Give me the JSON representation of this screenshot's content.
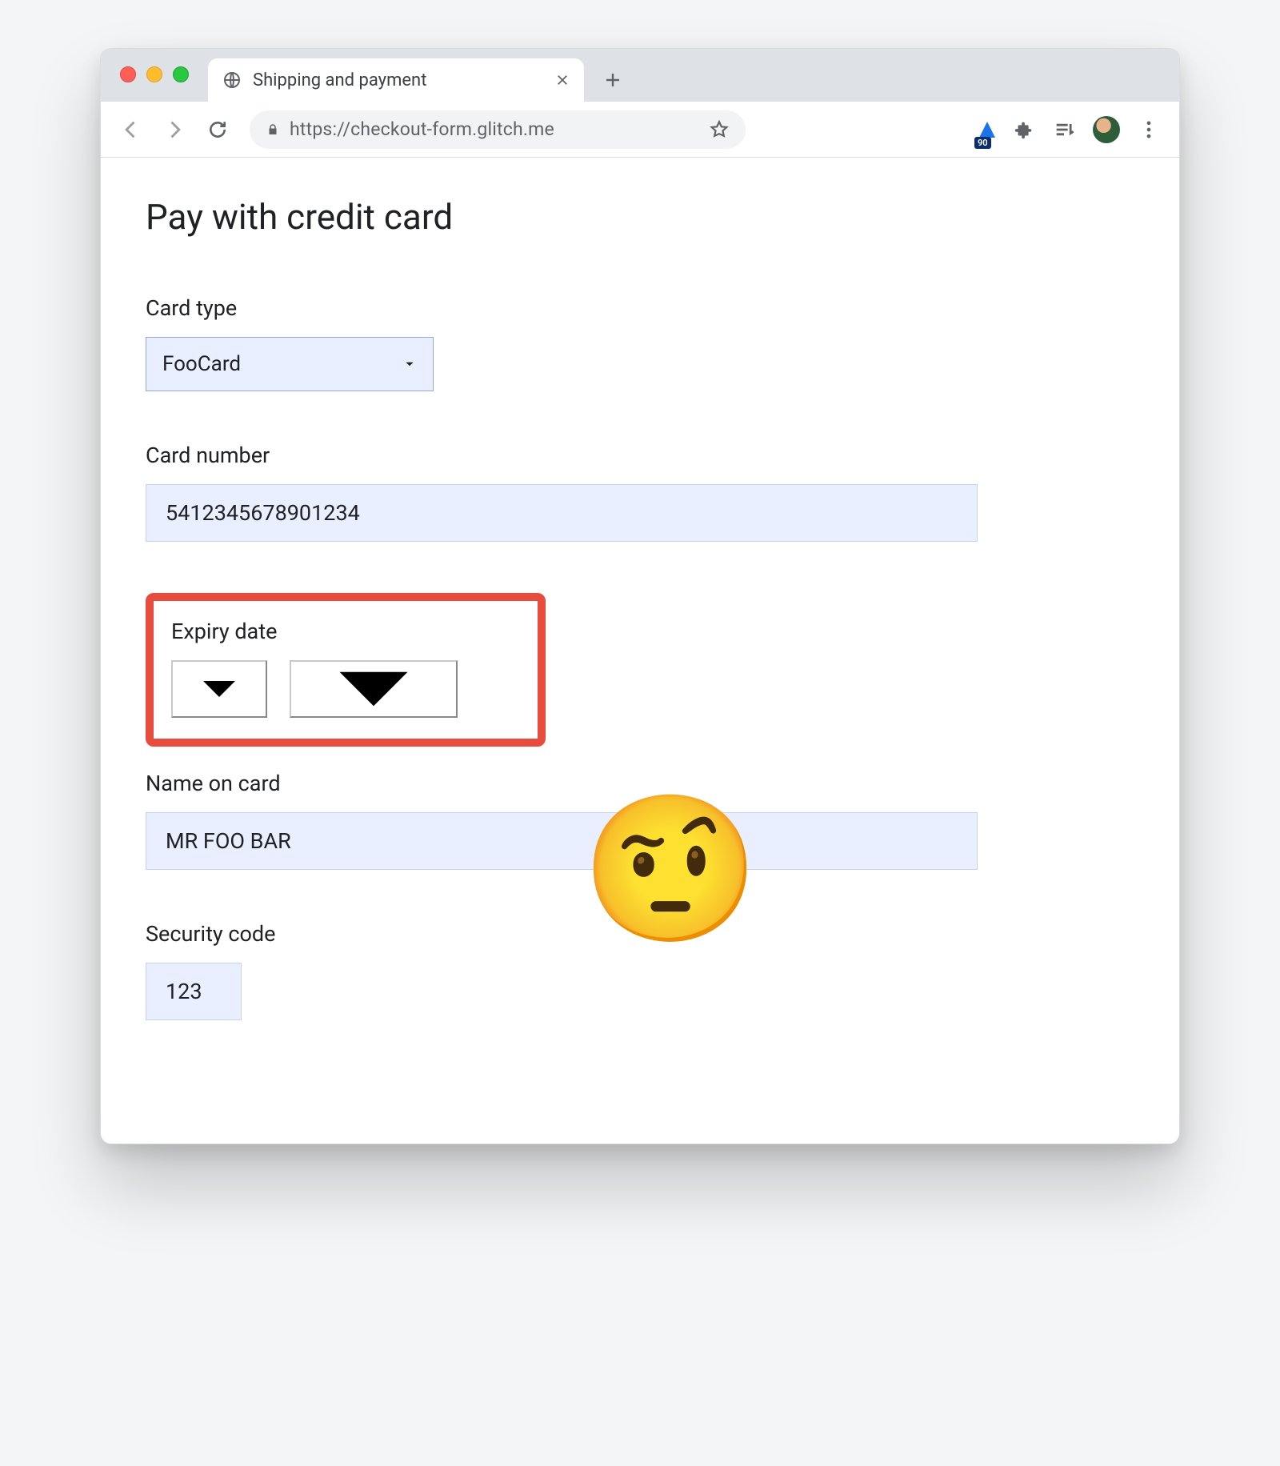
{
  "tab": {
    "title": "Shipping and payment"
  },
  "toolbar": {
    "url": "https://checkout-form.glitch.me",
    "lighthouse_badge": "90"
  },
  "page": {
    "heading": "Pay with credit card",
    "card_type": {
      "label": "Card type",
      "value": "FooCard"
    },
    "card_number": {
      "label": "Card number",
      "value": "5412345678901234"
    },
    "expiry": {
      "label": "Expiry date",
      "month": "",
      "year": ""
    },
    "name": {
      "label": "Name on card",
      "value": "MR FOO BAR"
    },
    "security": {
      "label": "Security code",
      "value": "123"
    },
    "emoji": "🤨"
  }
}
